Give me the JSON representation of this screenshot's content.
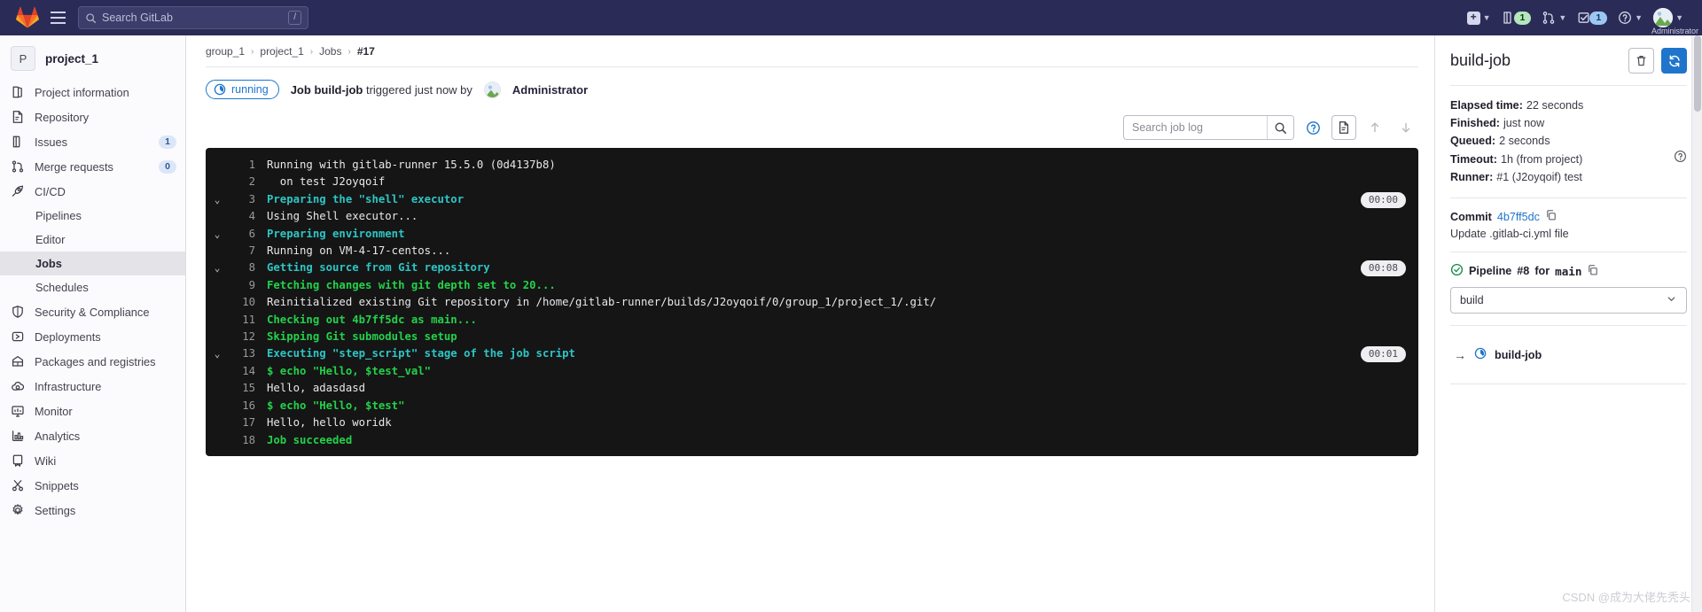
{
  "navbar": {
    "logo_icon": "gitlab-logo-icon",
    "menu_icon": "hamburger-menu-icon",
    "search": {
      "placeholder": "Search GitLab",
      "value": "",
      "shortcut": "/",
      "icon": "search-icon"
    },
    "items": [
      {
        "name": "create-new",
        "icon": "plus-square-icon",
        "count": ""
      },
      {
        "name": "issues",
        "icon": "issues-icon",
        "count": "1"
      },
      {
        "name": "merge-requests",
        "icon": "merge-request-icon",
        "count": ""
      },
      {
        "name": "todos",
        "icon": "todo-checkbox-icon",
        "count": "1"
      },
      {
        "name": "help",
        "icon": "question-circle-icon",
        "count": ""
      }
    ],
    "user": {
      "name": "Administrator",
      "avatar_icon": "user-avatar-icon"
    }
  },
  "sidebar": {
    "project": {
      "initial": "P",
      "name": "project_1"
    },
    "items": [
      {
        "label": "Project information",
        "icon": "book-icon",
        "badge": "",
        "sub": false,
        "active": false
      },
      {
        "label": "Repository",
        "icon": "document-icon",
        "badge": "",
        "sub": false,
        "active": false
      },
      {
        "label": "Issues",
        "icon": "issues-icon",
        "badge": "1",
        "sub": false,
        "active": false
      },
      {
        "label": "Merge requests",
        "icon": "merge-request-icon",
        "badge": "0",
        "sub": false,
        "active": false
      },
      {
        "label": "CI/CD",
        "icon": "rocket-icon",
        "badge": "",
        "sub": false,
        "active": false
      },
      {
        "label": "Pipelines",
        "icon": "",
        "badge": "",
        "sub": true,
        "active": false
      },
      {
        "label": "Editor",
        "icon": "",
        "badge": "",
        "sub": true,
        "active": false
      },
      {
        "label": "Jobs",
        "icon": "",
        "badge": "",
        "sub": true,
        "active": true
      },
      {
        "label": "Schedules",
        "icon": "",
        "badge": "",
        "sub": true,
        "active": false
      },
      {
        "label": "Security & Compliance",
        "icon": "shield-icon",
        "badge": "",
        "sub": false,
        "active": false
      },
      {
        "label": "Deployments",
        "icon": "deployments-icon",
        "badge": "",
        "sub": false,
        "active": false
      },
      {
        "label": "Packages and registries",
        "icon": "package-icon",
        "badge": "",
        "sub": false,
        "active": false
      },
      {
        "label": "Infrastructure",
        "icon": "cloud-gear-icon",
        "badge": "",
        "sub": false,
        "active": false
      },
      {
        "label": "Monitor",
        "icon": "monitor-icon",
        "badge": "",
        "sub": false,
        "active": false
      },
      {
        "label": "Analytics",
        "icon": "chart-bar-icon",
        "badge": "",
        "sub": false,
        "active": false
      },
      {
        "label": "Wiki",
        "icon": "book-open-icon",
        "badge": "",
        "sub": false,
        "active": false
      },
      {
        "label": "Snippets",
        "icon": "scissors-icon",
        "badge": "",
        "sub": false,
        "active": false
      },
      {
        "label": "Settings",
        "icon": "gear-icon",
        "badge": "",
        "sub": false,
        "active": false
      }
    ]
  },
  "breadcrumb": {
    "items": [
      "group_1",
      "project_1",
      "Jobs"
    ],
    "current": "#17"
  },
  "job_header": {
    "status": "running",
    "status_icon": "running-clock-icon",
    "prefix": "Job",
    "job_name": "build-job",
    "middle": "triggered just now by",
    "user": "Administrator"
  },
  "log_toolbar": {
    "search_placeholder": "Search job log",
    "search_value": "",
    "search_icon": "search-icon",
    "help_icon": "question-circle-icon",
    "raw_icon": "document-raw-icon",
    "scroll_top_icon": "scroll-to-top-icon",
    "scroll_bottom_icon": "scroll-to-bottom-icon"
  },
  "log": {
    "lines": [
      {
        "n": "1",
        "text": "Running with gitlab-runner 15.5.0 (0d4137b8)",
        "color": "white",
        "collapsible": false,
        "time": ""
      },
      {
        "n": "2",
        "text": "  on test J2oyqoif",
        "color": "white",
        "collapsible": false,
        "time": ""
      },
      {
        "n": "3",
        "text": "Preparing the \"shell\" executor",
        "color": "cyan",
        "collapsible": true,
        "time": "00:00"
      },
      {
        "n": "4",
        "text": "Using Shell executor...",
        "color": "white",
        "collapsible": false,
        "time": ""
      },
      {
        "n": "6",
        "text": "Preparing environment",
        "color": "cyan",
        "collapsible": true,
        "time": ""
      },
      {
        "n": "7",
        "text": "Running on VM-4-17-centos...",
        "color": "white",
        "collapsible": false,
        "time": ""
      },
      {
        "n": "8",
        "text": "Getting source from Git repository",
        "color": "cyan",
        "collapsible": true,
        "time": "00:08"
      },
      {
        "n": "9",
        "text": "Fetching changes with git depth set to 20...",
        "color": "green",
        "collapsible": false,
        "time": ""
      },
      {
        "n": "10",
        "text": "Reinitialized existing Git repository in /home/gitlab-runner/builds/J2oyqoif/0/group_1/project_1/.git/",
        "color": "white",
        "collapsible": false,
        "time": ""
      },
      {
        "n": "11",
        "text": "Checking out 4b7ff5dc as main...",
        "color": "green",
        "collapsible": false,
        "time": ""
      },
      {
        "n": "12",
        "text": "Skipping Git submodules setup",
        "color": "green",
        "collapsible": false,
        "time": ""
      },
      {
        "n": "13",
        "text": "Executing \"step_script\" stage of the job script",
        "color": "cyan",
        "collapsible": true,
        "time": "00:01"
      },
      {
        "n": "14",
        "text": "$ echo \"Hello, $test_val\"",
        "color": "green",
        "collapsible": false,
        "time": ""
      },
      {
        "n": "15",
        "text": "Hello, adasdasd",
        "color": "white",
        "collapsible": false,
        "time": ""
      },
      {
        "n": "16",
        "text": "$ echo \"Hello, $test\"",
        "color": "green",
        "collapsible": false,
        "time": ""
      },
      {
        "n": "17",
        "text": "Hello, hello woridk",
        "color": "white",
        "collapsible": false,
        "time": ""
      },
      {
        "n": "18",
        "text": "Job succeeded",
        "color": "green",
        "collapsible": false,
        "time": ""
      }
    ]
  },
  "rightbar": {
    "title": "build-job",
    "delete_icon": "trash-icon",
    "retry_icon": "retry-refresh-icon",
    "details": [
      {
        "label": "Elapsed time:",
        "value": "22 seconds",
        "help": false
      },
      {
        "label": "Finished:",
        "value": "just now",
        "help": false
      },
      {
        "label": "Queued:",
        "value": "2 seconds",
        "help": false
      },
      {
        "label": "Timeout:",
        "value": "1h (from project)",
        "help": true
      },
      {
        "label": "Runner:",
        "value": "#1 (J2oyqoif) test",
        "help": false
      }
    ],
    "commit": {
      "label": "Commit",
      "sha": "4b7ff5dc",
      "copy_icon": "copy-icon",
      "message": "Update .gitlab-ci.yml file"
    },
    "pipeline": {
      "status_icon": "check-circle-icon",
      "label": "Pipeline",
      "number": "#8",
      "for_text": "for",
      "ref": "main",
      "copy_icon": "copy-icon"
    },
    "stage_select": {
      "value": "build",
      "caret_icon": "chevron-down-icon"
    },
    "jobs": [
      {
        "name": "build-job",
        "arrow_icon": "arrow-right-icon",
        "status_icon": "running-clock-icon"
      }
    ]
  },
  "watermark": "CSDN @成为大佬先秃头",
  "colors": {
    "navbar_bg": "#2b2b58",
    "accent": "#1f75cb",
    "console_bg": "#151515",
    "green": "#23d14a",
    "cyan": "#2ec5c5"
  }
}
